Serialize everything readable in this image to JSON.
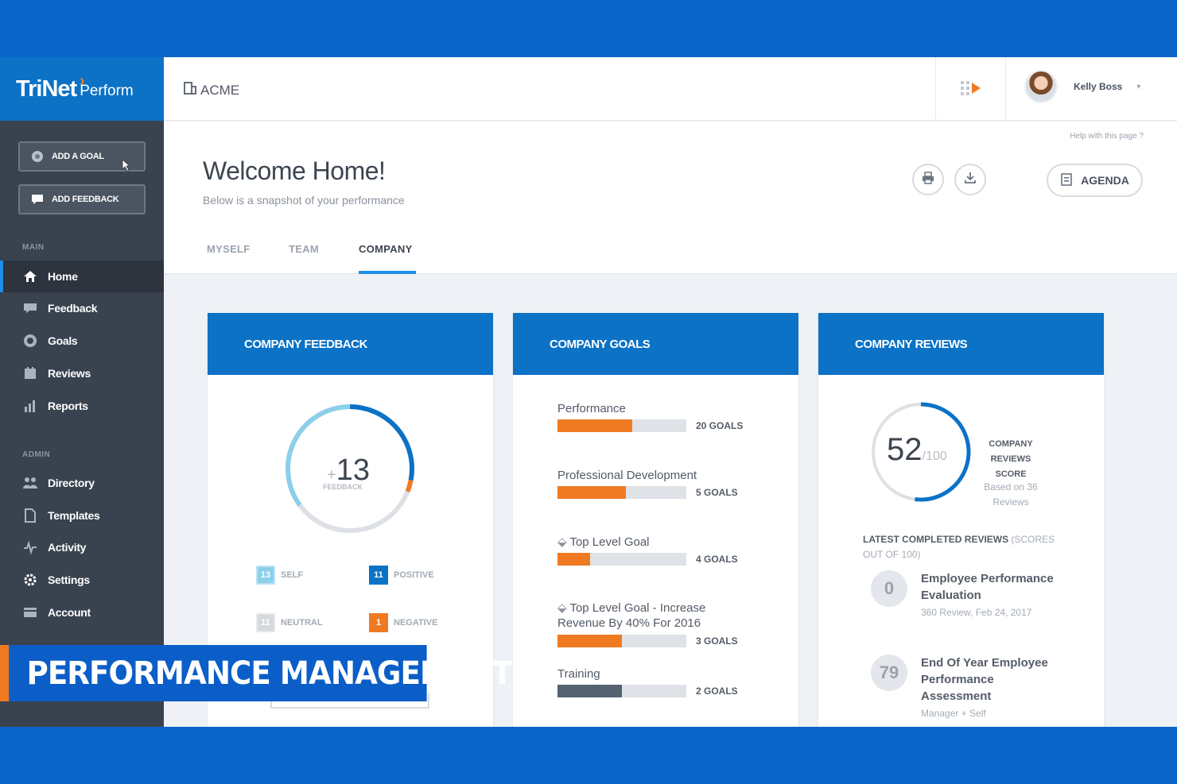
{
  "brand": {
    "name": "TriNet",
    "product": "Perform",
    "accent": "#0b72c6",
    "highlight": "#f07a22"
  },
  "sidebar": {
    "buttons": [
      {
        "label": "ADD A GOAL",
        "icon": "target-icon"
      },
      {
        "label": "ADD FEEDBACK",
        "icon": "chat-icon"
      }
    ],
    "main_section": "MAIN",
    "main_items": [
      {
        "label": "Home",
        "icon": "home-icon",
        "active": true
      },
      {
        "label": "Feedback",
        "icon": "chat-icon"
      },
      {
        "label": "Goals",
        "icon": "target-icon"
      },
      {
        "label": "Reviews",
        "icon": "calendar-icon"
      },
      {
        "label": "Reports",
        "icon": "bar-chart-icon"
      }
    ],
    "admin_section": "ADMIN",
    "admin_items": [
      {
        "label": "Directory",
        "icon": "people-icon"
      },
      {
        "label": "Templates",
        "icon": "document-icon"
      },
      {
        "label": "Activity",
        "icon": "pulse-icon"
      },
      {
        "label": "Settings",
        "icon": "gear-icon"
      },
      {
        "label": "Account",
        "icon": "card-icon"
      }
    ]
  },
  "topbar": {
    "org": "ACME",
    "user_name": "Kelly Boss"
  },
  "page": {
    "help": "Help with this page ?",
    "title": "Welcome Home!",
    "subtitle": "Below is a snapshot of your performance",
    "agenda_label": "AGENDA",
    "tabs": [
      {
        "label": "MYSELF"
      },
      {
        "label": "TEAM"
      },
      {
        "label": "COMPANY",
        "active": true
      }
    ]
  },
  "feedback_card": {
    "title": "COMPANY FEEDBACK",
    "total_prefix": "+",
    "total": "13",
    "total_label": "FEEDBACK",
    "ring_fraction_self": 0.35,
    "legend": [
      {
        "count": "13",
        "label": "SELF",
        "color": "#8ccfea"
      },
      {
        "count": "11",
        "label": "POSITIVE",
        "color": "#0b72c6"
      },
      {
        "count": "11",
        "label": "NEUTRAL",
        "color": "#d5d8dc"
      },
      {
        "count": "1",
        "label": "NEGATIVE",
        "color": "#f07a22"
      }
    ]
  },
  "goals_card": {
    "title": "COMPANY GOALS",
    "goals": [
      {
        "label": "Performance",
        "count": "20 GOALS",
        "progress": 0.58,
        "fill": "#f07a22",
        "has_icon": false
      },
      {
        "label": "Professional Development",
        "count": "5 GOALS",
        "progress": 0.53,
        "fill": "#f07a22",
        "has_icon": false
      },
      {
        "label": "Top Level Goal",
        "count": "4 GOALS",
        "progress": 0.25,
        "fill": "#f07a22",
        "has_icon": true
      },
      {
        "label": "Top Level Goal - Increase Revenue By 40% For 2016",
        "count": "3 GOALS",
        "progress": 0.5,
        "fill": "#f07a22",
        "has_icon": true
      },
      {
        "label": "Training",
        "count": "2 GOALS",
        "progress": 0.5,
        "fill": "#556270",
        "has_icon": false
      }
    ]
  },
  "reviews_card": {
    "title": "COMPANY REVIEWS",
    "score": "52",
    "score_max": "/100",
    "score_fraction": 0.52,
    "score_label": "COMPANY REVIEWS SCORE",
    "based_on": "Based on 36 Reviews",
    "latest_label": "LATEST COMPLETED REVIEWS",
    "latest_suffix": "(SCORES OUT OF 100)",
    "items": [
      {
        "score": "0",
        "title": "Employee Performance Evaluation",
        "meta": "360 Review, Feb 24, 2017"
      },
      {
        "score": "79",
        "title": "End Of Year Employee Performance Assessment",
        "meta": "Manager + Self"
      }
    ]
  },
  "banner": {
    "text": "PERFORMANCE MANAGEMENT"
  }
}
